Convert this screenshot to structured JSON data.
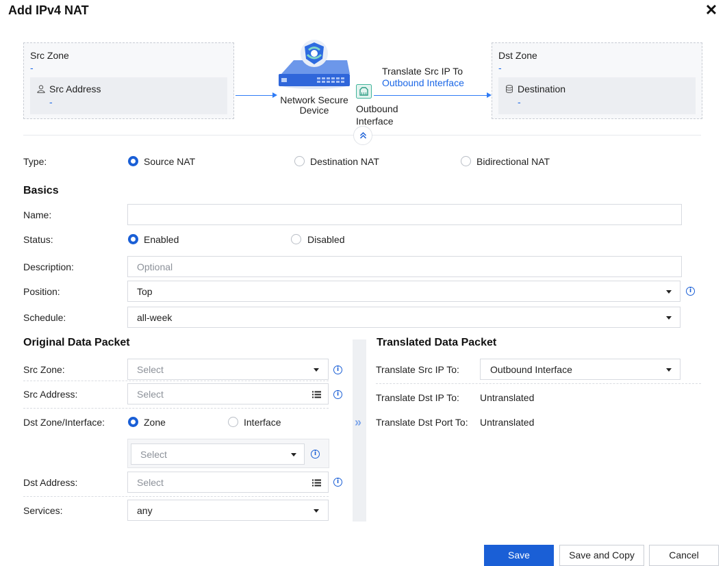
{
  "dialog": {
    "title": "Add IPv4 NAT"
  },
  "diagram": {
    "src_zone": {
      "title": "Src Zone",
      "value": "-",
      "address_label": "Src Address",
      "address_value": "-"
    },
    "device_label": "Network Secure Device",
    "translate_label": "Translate Src IP To",
    "translate_value": "Outbound Interface",
    "outbound_label": "Outbound Interface",
    "dst_zone": {
      "title": "Dst Zone",
      "value": "-",
      "destination_label": "Destination",
      "destination_value": "-"
    }
  },
  "type": {
    "label": "Type:",
    "options": [
      "Source NAT",
      "Destination NAT",
      "Bidirectional NAT"
    ],
    "selected": "Source NAT"
  },
  "basics": {
    "heading": "Basics",
    "name_label": "Name:",
    "name_value": "",
    "status_label": "Status:",
    "status_options": [
      "Enabled",
      "Disabled"
    ],
    "status_selected": "Enabled",
    "description_label": "Description:",
    "description_placeholder": "Optional",
    "position_label": "Position:",
    "position_value": "Top",
    "schedule_label": "Schedule:",
    "schedule_value": "all-week"
  },
  "original": {
    "heading": "Original Data Packet",
    "src_zone_label": "Src Zone:",
    "src_zone_placeholder": "Select",
    "src_address_label": "Src Address:",
    "src_address_placeholder": "Select",
    "dst_zone_interface_label": "Dst Zone/Interface:",
    "dst_options": [
      "Zone",
      "Interface"
    ],
    "dst_selected": "Zone",
    "dst_zone_placeholder": "Select",
    "dst_address_label": "Dst Address:",
    "dst_address_placeholder": "Select",
    "services_label": "Services:",
    "services_value": "any"
  },
  "translated": {
    "heading": "Translated Data Packet",
    "src_ip_label": "Translate Src IP To:",
    "src_ip_value": "Outbound Interface",
    "dst_ip_label": "Translate Dst IP To:",
    "dst_ip_value": "Untranslated",
    "dst_port_label": "Translate Dst Port To:",
    "dst_port_value": "Untranslated"
  },
  "footer": {
    "save": "Save",
    "save_copy": "Save and Copy",
    "cancel": "Cancel"
  },
  "colors": {
    "primary": "#1a5fd6",
    "link": "#1a66e6",
    "zone_bg": "#f7f8fa"
  },
  "icons": {
    "close": "close-icon",
    "user": "user-icon",
    "database": "database-icon",
    "collapse": "chevron-double-up-icon",
    "expand": "chevron-double-right-icon",
    "info": "info-icon",
    "list": "list-icon",
    "caret": "caret-down-icon"
  }
}
